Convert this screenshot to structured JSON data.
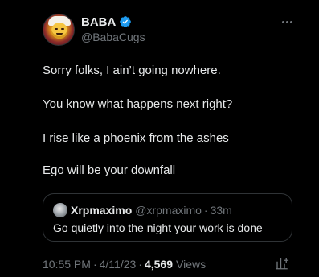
{
  "author": {
    "display_name": "BABA",
    "handle": "@BabaCugs",
    "verified": true,
    "verified_color": "#1d9bf0"
  },
  "tweet": {
    "lines": [
      "Sorry folks, I ain’t going nowhere.",
      "You know what happens next right?",
      "I rise like a phoenix from the ashes",
      "Ego will be your downfall"
    ]
  },
  "quote": {
    "display_name": "Xrpmaximo",
    "handle": "@xrpmaximo",
    "separator": "·",
    "time": "33m",
    "text": "Go quietly into the night your work is done"
  },
  "meta": {
    "time": "10:55 PM",
    "separator_1": "·",
    "date": "4/11/23",
    "separator_2": "·",
    "views_count": "4,569",
    "views_label": "Views"
  },
  "icons": {
    "more": "more-horizontal-icon",
    "verified": "verified-badge-icon",
    "analytics": "analytics-icon"
  },
  "colors": {
    "background": "#000000",
    "text_primary": "#e7e9ea",
    "text_secondary": "#71767b",
    "border": "#2f3336"
  }
}
